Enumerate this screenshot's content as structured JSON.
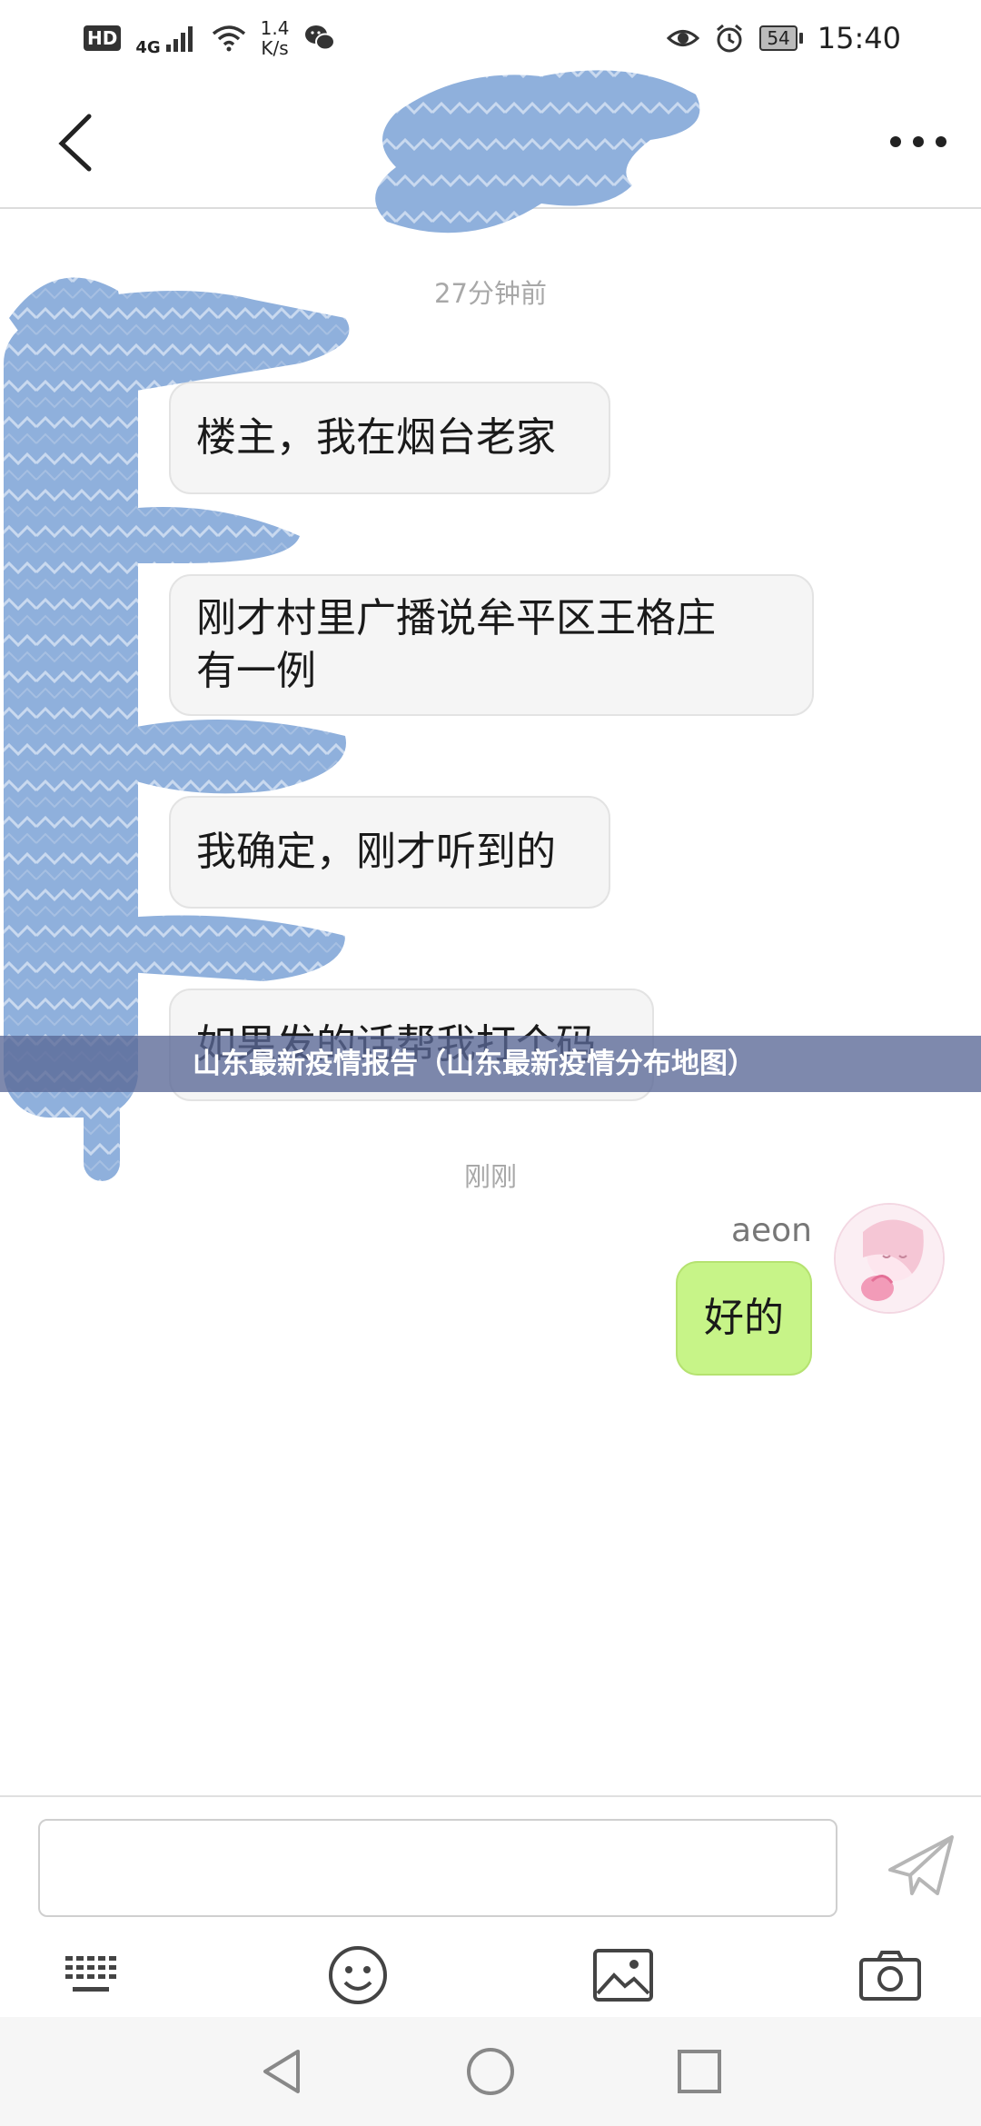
{
  "status_bar": {
    "hd": "HD",
    "network": "4G",
    "speed_value": "1.4",
    "speed_unit": "K/s",
    "battery": "54",
    "time": "15:40"
  },
  "chat": {
    "timestamp_earlier": "27分钟前",
    "timestamp_recent": "刚刚",
    "messages_left": [
      {
        "line1": "楼主，我在烟台老家",
        "line2": ""
      },
      {
        "line1": "刚才村里广播说牟平区王格庄",
        "line2": "有一例"
      },
      {
        "line1": "我确定，刚才听到的",
        "line2": ""
      },
      {
        "line1": "如果发的话帮我打个码",
        "line2": ""
      }
    ],
    "sender_name": "aeon",
    "message_right": "好的"
  },
  "banner": {
    "title": "山东最新疫情报告（山东最新疫情分布地图）"
  },
  "input": {
    "value": "",
    "placeholder": ""
  },
  "icons": {
    "back": "chevron-left-icon",
    "more": "more-dots-icon",
    "send": "send-icon",
    "keyboard": "keyboard-icon",
    "emoji": "emoji-icon",
    "image": "image-icon",
    "camera": "camera-icon"
  },
  "colors": {
    "right_bubble": "#c7f488",
    "left_bubble": "#f5f5f5",
    "banner": "#5a6896",
    "redaction": "#8fb0dc"
  }
}
